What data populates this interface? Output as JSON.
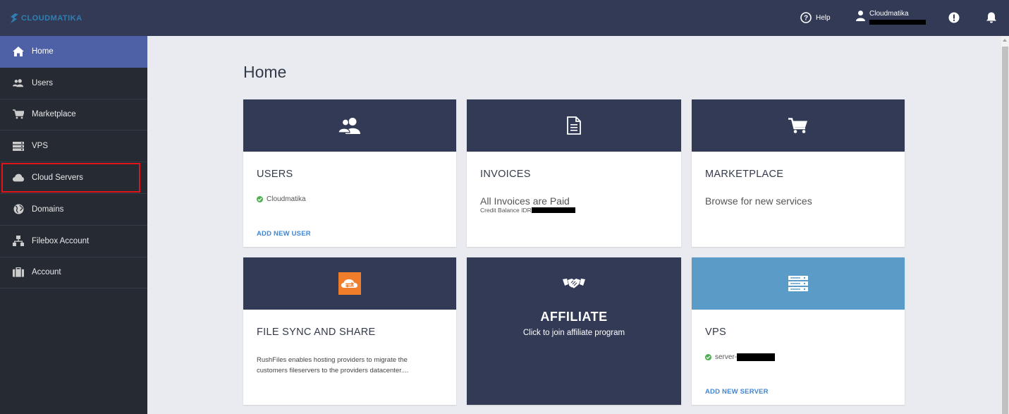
{
  "brand": {
    "logo_text": "CLOUDMATIKA"
  },
  "topbar": {
    "help_label": "Help",
    "user_name": "Cloudmatika"
  },
  "sidebar": {
    "items": [
      {
        "label": "Home",
        "icon": "home-icon"
      },
      {
        "label": "Users",
        "icon": "users-icon"
      },
      {
        "label": "Marketplace",
        "icon": "cart-icon"
      },
      {
        "label": "VPS",
        "icon": "server-icon"
      },
      {
        "label": "Cloud Servers",
        "icon": "cloud-icon"
      },
      {
        "label": "Domains",
        "icon": "globe-icon"
      },
      {
        "label": "Filebox Account",
        "icon": "sitemap-icon"
      },
      {
        "label": "Account",
        "icon": "briefcase-icon"
      }
    ]
  },
  "main": {
    "title": "Home",
    "cards": {
      "users": {
        "title": "USERS",
        "status_user": "Cloudmatika",
        "link": "ADD NEW USER"
      },
      "invoices": {
        "title": "INVOICES",
        "status": "All Invoices are Paid",
        "credit_label": "Credit Balance IDR"
      },
      "marketplace": {
        "title": "MARKETPLACE",
        "text": "Browse for new services"
      },
      "filesync": {
        "title": "FILE SYNC AND SHARE",
        "description": "RushFiles enables hosting providers to migrate the customers fileservers to the providers datacenter...."
      },
      "affiliate": {
        "title": "AFFILIATE",
        "subtitle": "Click to join affiliate program"
      },
      "vps": {
        "title": "VPS",
        "server_prefix": "server-",
        "link": "ADD NEW SERVER"
      }
    }
  },
  "colors": {
    "topbar": "#323a56",
    "sidebar": "#262a33",
    "sidebar_active": "#4e61a6",
    "highlight_border": "#e0141b",
    "link": "#3f86d3",
    "vps_header": "#5b9bc8",
    "rushfiles_orange": "#f07d2a",
    "status_green": "#4cb050"
  }
}
